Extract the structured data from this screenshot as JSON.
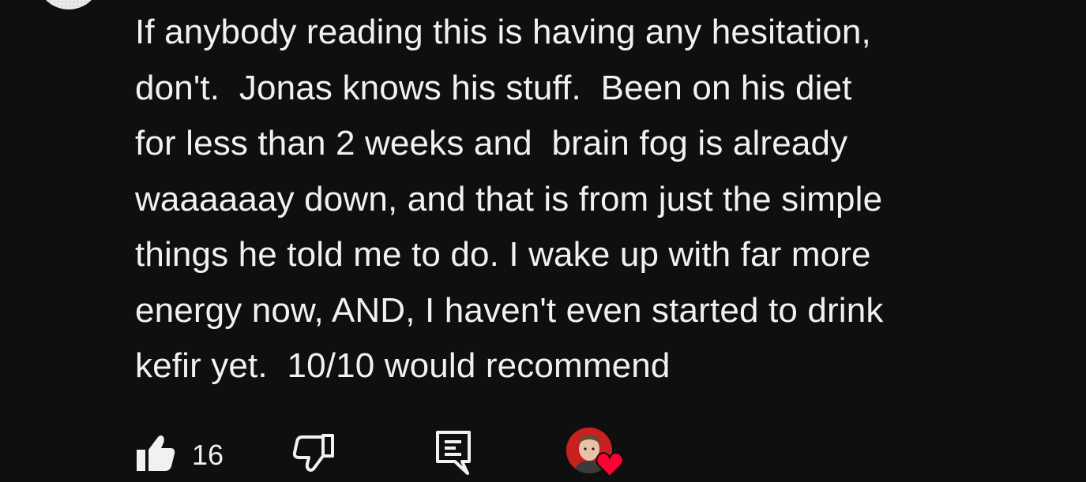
{
  "comment": {
    "lines": [
      "If anybody reading this is having any hesitation,",
      "don't.  Jonas knows his stuff.  Been on his diet",
      "for less than 2 weeks and  brain fog is already",
      "waaaaaay down, and that is from just the simple",
      "things he told me to do. I wake up with far more",
      "energy now, AND, I haven't even started to drink",
      "kefir yet.  10/10 would recommend"
    ]
  },
  "actions": {
    "like_count": "16",
    "icons": {
      "like": "thumbs-up-icon",
      "dislike": "thumbs-down-icon",
      "reply": "reply-comment-icon",
      "creator_heart": "creator-heart-icon"
    }
  },
  "colors": {
    "background": "#0f0f0f",
    "text": "#f1f1f1",
    "heart": "#ff0033"
  }
}
